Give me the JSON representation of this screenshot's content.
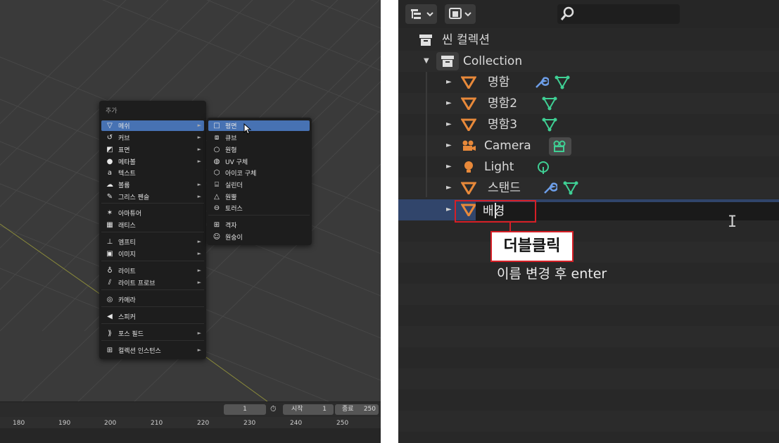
{
  "add_menu": {
    "title": "추가",
    "items": [
      {
        "icon": "mesh-icon",
        "label": "메쉬",
        "submenu": true,
        "selected": true
      },
      {
        "icon": "curve-icon",
        "label": "커브",
        "submenu": true
      },
      {
        "icon": "surface-icon",
        "label": "표면",
        "submenu": true
      },
      {
        "icon": "metaball-icon",
        "label": "메타볼",
        "submenu": true
      },
      {
        "icon": "text-icon",
        "label": "텍스트",
        "submenu": false
      },
      {
        "icon": "volume-icon",
        "label": "볼륨",
        "submenu": true
      },
      {
        "icon": "grease-pencil-icon",
        "label": "그리스 펜슬",
        "submenu": true
      },
      {
        "icon": "armature-icon",
        "label": "아마튜어",
        "submenu": false
      },
      {
        "icon": "lattice-icon",
        "label": "래티스",
        "submenu": false
      },
      {
        "icon": "empty-icon",
        "label": "엠프티",
        "submenu": true
      },
      {
        "icon": "image-icon",
        "label": "이미지",
        "submenu": true
      },
      {
        "icon": "light-icon",
        "label": "라이트",
        "submenu": true
      },
      {
        "icon": "light-probe-icon",
        "label": "라이트 프로브",
        "submenu": true
      },
      {
        "icon": "camera-icon",
        "label": "카메라",
        "submenu": false
      },
      {
        "icon": "speaker-icon",
        "label": "스피커",
        "submenu": false
      },
      {
        "icon": "force-field-icon",
        "label": "포스 필드",
        "submenu": true
      },
      {
        "icon": "collection-instance-icon",
        "label": "컬렉션 인스턴스",
        "submenu": true
      }
    ]
  },
  "mesh_menu": {
    "items": [
      {
        "icon": "plane-icon",
        "label": "평면",
        "selected": true
      },
      {
        "icon": "cube-icon",
        "label": "큐브"
      },
      {
        "icon": "circle-icon",
        "label": "원형"
      },
      {
        "icon": "uv-sphere-icon",
        "label": "UV 구체"
      },
      {
        "icon": "ico-sphere-icon",
        "label": "아이코 구체"
      },
      {
        "icon": "cylinder-icon",
        "label": "실린더"
      },
      {
        "icon": "cone-icon",
        "label": "원뿔"
      },
      {
        "icon": "torus-icon",
        "label": "토러스"
      },
      {
        "icon": "grid-icon",
        "label": "격자"
      },
      {
        "icon": "monkey-icon",
        "label": "원숭이"
      }
    ]
  },
  "timeline": {
    "current_frame": "1",
    "start_label": "시작",
    "start_value": "1",
    "end_label": "종료",
    "end_value": "250",
    "ruler": [
      "180",
      "190",
      "200",
      "210",
      "220",
      "230",
      "240",
      "250"
    ]
  },
  "outliner": {
    "scene_collection": "씬 컬렉션",
    "collection": "Collection",
    "objects": [
      {
        "name": "명함",
        "type": "mesh",
        "modifier": true
      },
      {
        "name": "명함2",
        "type": "mesh",
        "modifier": false
      },
      {
        "name": "명함3",
        "type": "mesh",
        "modifier": false
      },
      {
        "name": "Camera",
        "type": "camera"
      },
      {
        "name": "Light",
        "type": "light"
      },
      {
        "name": "스탠드",
        "type": "mesh",
        "modifier": true
      }
    ],
    "editing_name": "배경"
  },
  "annotation": {
    "callout": "더블클릭",
    "subtext": "이름 변경 후 enter"
  },
  "colors": {
    "mesh_orange": "#e8893a",
    "data_green": "#3fcf94",
    "modifier_blue": "#6d9ee8",
    "selection_blue": "#4772b3",
    "highlight_red": "#d61f26"
  }
}
